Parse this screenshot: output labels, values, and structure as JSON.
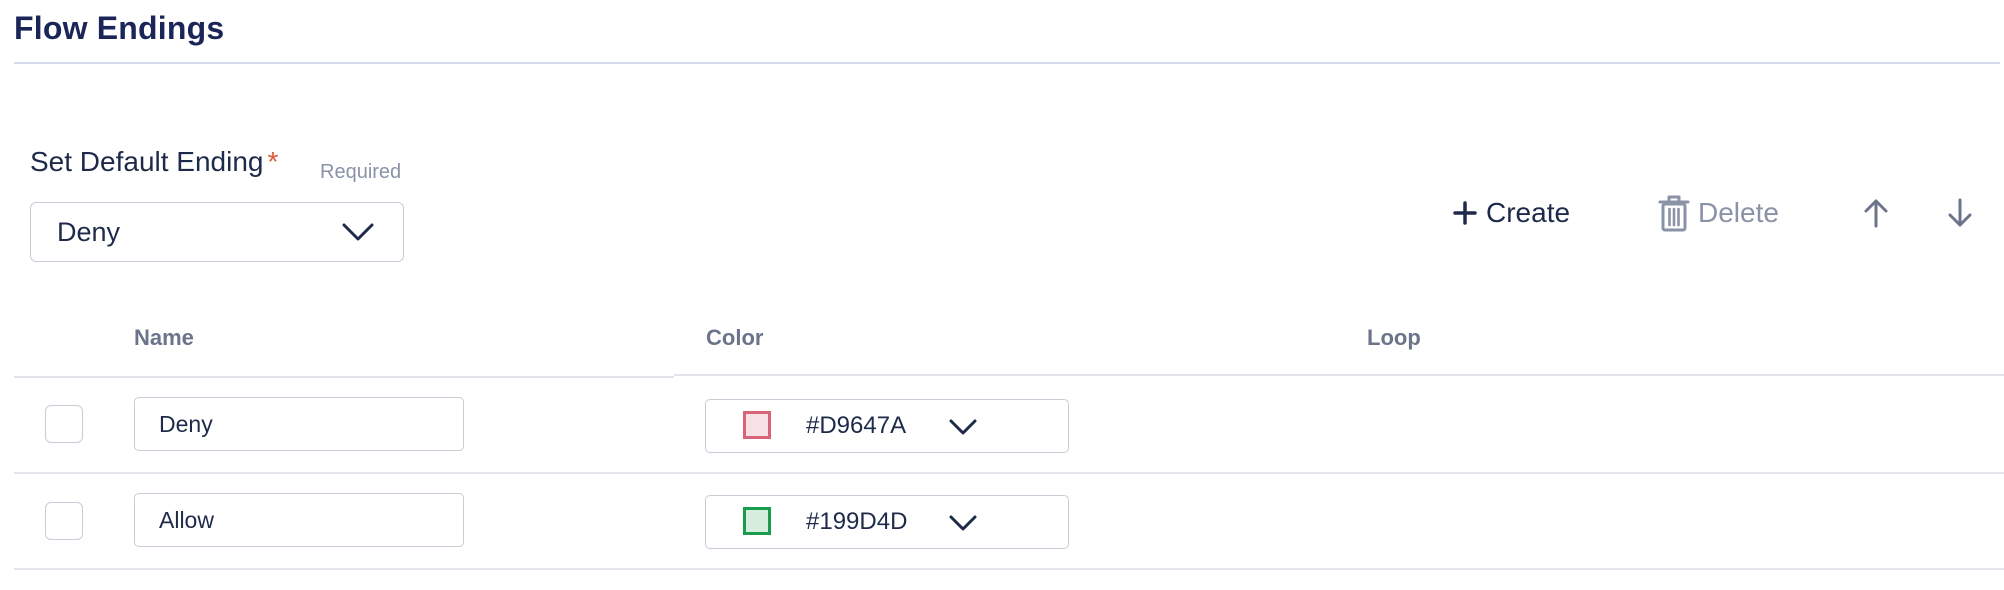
{
  "section": {
    "title": "Flow Endings"
  },
  "default_ending": {
    "label": "Set Default Ending",
    "required_mark": "*",
    "required_hint": "Required",
    "selected": "Deny"
  },
  "toolbar": {
    "create_label": "Create",
    "delete_label": "Delete",
    "icons": [
      "plus-icon",
      "trash-icon",
      "arrow-up-icon",
      "arrow-down-icon"
    ]
  },
  "table": {
    "columns": [
      "Name",
      "Color",
      "Loop"
    ],
    "rows": [
      {
        "name": "Deny",
        "color_hex": "#D9647A",
        "swatch_border": "#D9647A",
        "swatch_fill": "#F6E1E4",
        "checked": false
      },
      {
        "name": "Allow",
        "color_hex": "#199D4D",
        "swatch_border": "#199D4D",
        "swatch_fill": "#D6EEDD",
        "checked": false
      }
    ]
  },
  "colors": {
    "title": "#1B2558",
    "text": "#1E2A4A",
    "muted": "#8A92A8",
    "required_star": "#E0583A"
  }
}
